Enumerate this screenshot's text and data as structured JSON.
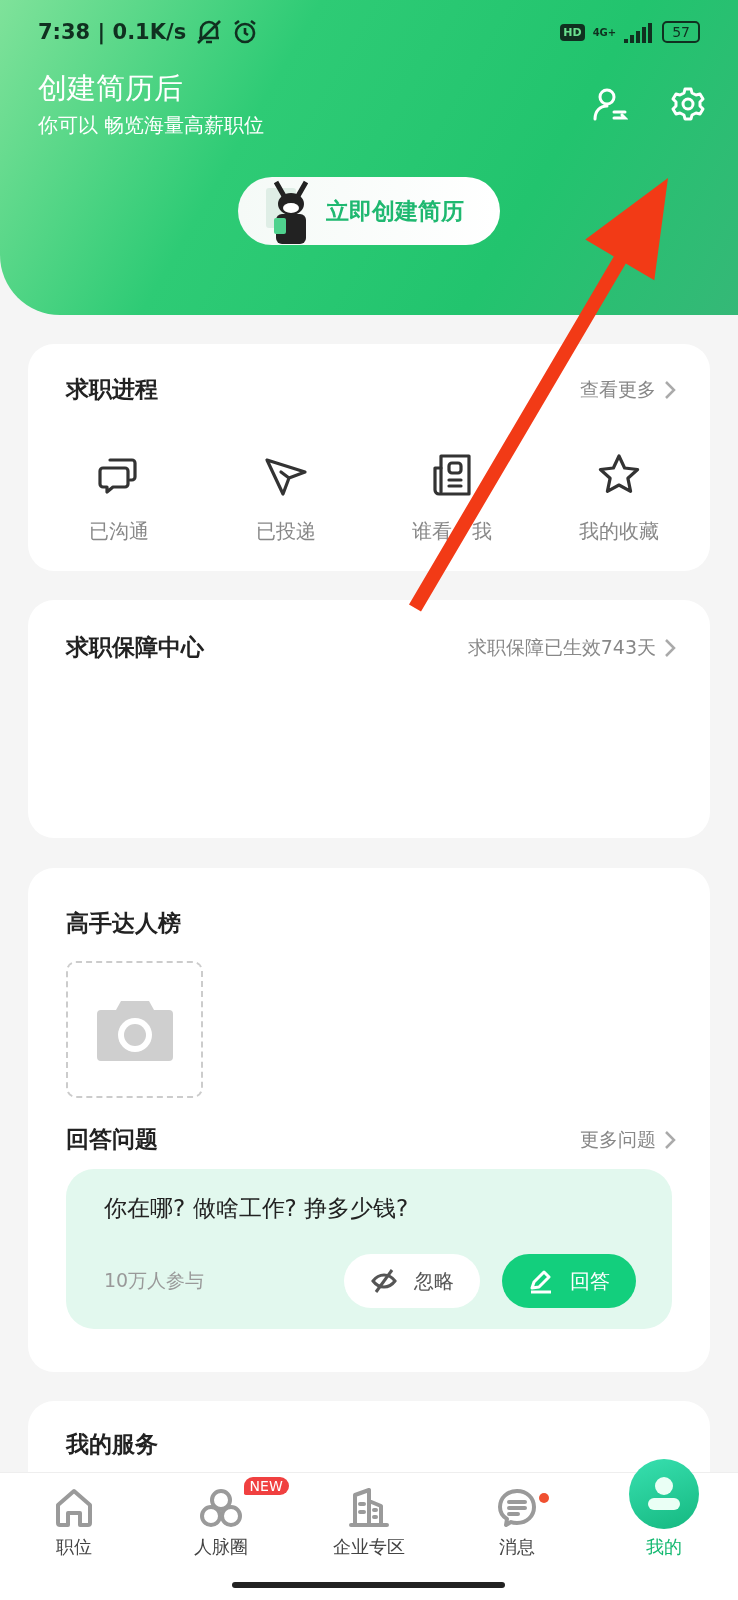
{
  "status_bar": {
    "time": "7:38 | 0.1K/s",
    "hd": "HD",
    "network": "4G+",
    "battery": "57"
  },
  "header": {
    "title": "创建简历后",
    "subtitle": "你可以 畅览海量高薪职位",
    "cta": "立即创建简历"
  },
  "progress": {
    "title": "求职进程",
    "more": "查看更多",
    "items": [
      {
        "kind": "chat",
        "label": "已沟通"
      },
      {
        "kind": "send",
        "label": "已投递"
      },
      {
        "kind": "resume",
        "label": "谁看　我"
      },
      {
        "kind": "star",
        "label": "我的收藏"
      }
    ]
  },
  "guarantee": {
    "title": "求职保障中心",
    "status": "求职保障已生效743天"
  },
  "experts": {
    "title": "高手达人榜"
  },
  "questions": {
    "title": "回答问题",
    "more": "更多问题",
    "question": "你在哪? 做啥工作? 挣多少钱?",
    "participants": "10万人参与",
    "ignore": "忽略",
    "answer": "回答"
  },
  "services": {
    "title": "我的服务"
  },
  "nav": [
    {
      "kind": "home",
      "label": "职位",
      "selected": false
    },
    {
      "kind": "circles",
      "label": "人脉圈",
      "selected": false,
      "badge": "NEW"
    },
    {
      "kind": "building",
      "label": "企业专区",
      "selected": false
    },
    {
      "kind": "message",
      "label": "消息",
      "selected": false,
      "dot": true
    },
    {
      "kind": "profile",
      "label": "我的",
      "selected": true
    }
  ]
}
